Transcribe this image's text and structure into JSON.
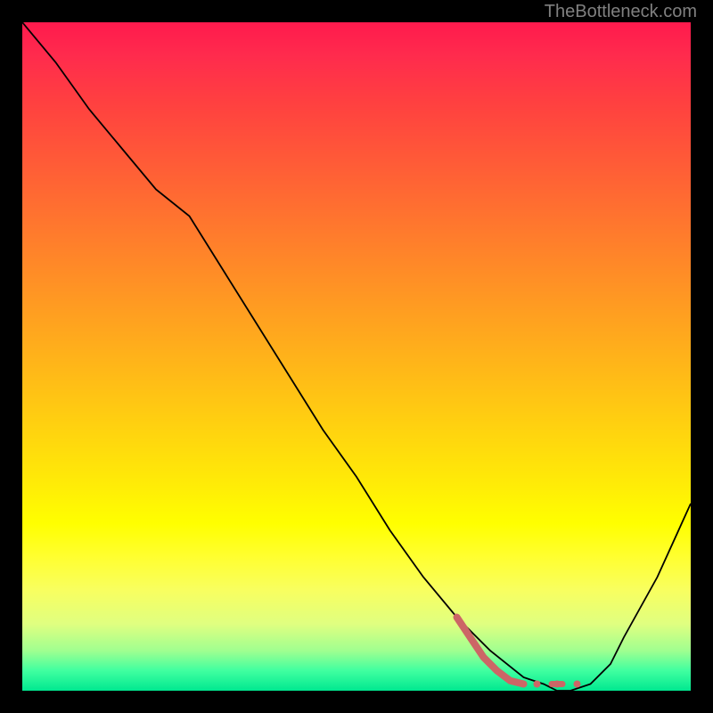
{
  "attribution": "TheBottleneck.com",
  "chart_data": {
    "type": "line",
    "title": "",
    "xlabel": "",
    "ylabel": "",
    "xlim": [
      0,
      100
    ],
    "ylim": [
      0,
      100
    ],
    "series": [
      {
        "name": "curve",
        "x": [
          0,
          5,
          10,
          15,
          20,
          25,
          30,
          35,
          40,
          45,
          50,
          55,
          60,
          65,
          70,
          75,
          78,
          80,
          82,
          85,
          88,
          90,
          95,
          100
        ],
        "y": [
          100,
          94,
          87,
          81,
          75,
          71,
          63,
          55,
          47,
          39,
          32,
          24,
          17,
          11,
          6,
          2,
          1,
          0,
          0,
          1,
          4,
          8,
          17,
          28
        ]
      }
    ],
    "markers": {
      "name": "highlighted-segment",
      "color": "#cc6666",
      "points": [
        {
          "x": 65,
          "y": 11
        },
        {
          "x": 67,
          "y": 8
        },
        {
          "x": 69,
          "y": 5
        },
        {
          "x": 71,
          "y": 3
        },
        {
          "x": 73,
          "y": 1.5
        },
        {
          "x": 75,
          "y": 1
        },
        {
          "x": 77,
          "y": 1
        },
        {
          "x": 80,
          "y": 1
        },
        {
          "x": 83,
          "y": 1
        }
      ]
    },
    "background_gradient": {
      "top": "#ff1a4d",
      "mid": "#ffff00",
      "bottom": "#00e890"
    }
  }
}
